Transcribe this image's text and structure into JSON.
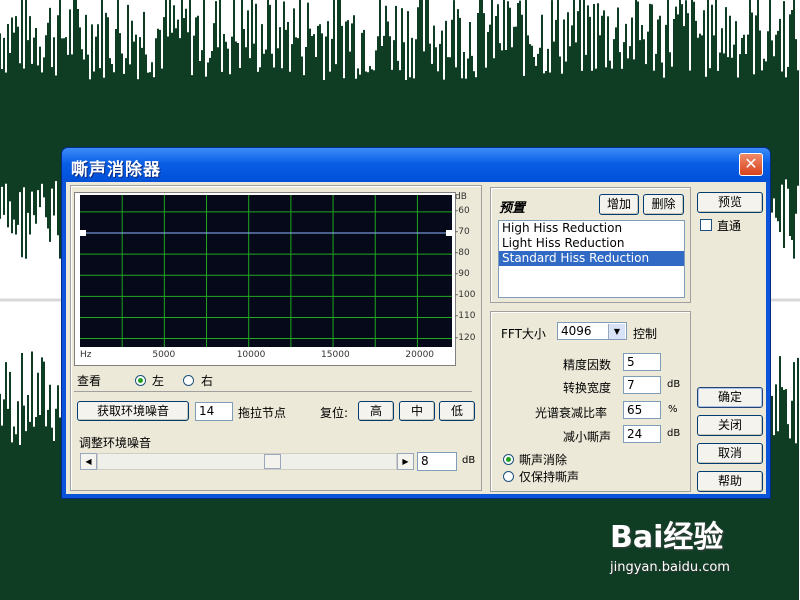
{
  "dialog": {
    "title": "嘶声消除器",
    "close_symbol": "✕"
  },
  "graph": {
    "db_unit": "dB",
    "db_ticks": [
      "-60",
      "-70",
      "-80",
      "-90",
      "-100",
      "-110",
      "-120"
    ],
    "hz_ticks": [
      "Hz",
      "5000",
      "10000",
      "15000",
      "20000"
    ],
    "noise_floor_db": -70
  },
  "view": {
    "label": "查看",
    "left": "左",
    "right": "右",
    "selected": "左"
  },
  "controls": {
    "get_noise_button": "获取环境噪音",
    "nodes_value": "14",
    "nodes_label": "拖拉节点",
    "reset_label": "复位:",
    "high": "高",
    "mid": "中",
    "low": "低",
    "adjust_label": "调整环境噪音",
    "adjust_value": "8",
    "adjust_unit": "dB",
    "slider_fraction": 0.59
  },
  "preset": {
    "title": "预置",
    "add": "增加",
    "delete": "删除",
    "items": [
      "High Hiss Reduction",
      "Light Hiss Reduction",
      "Standard Hiss Reduction"
    ],
    "selected_index": 2
  },
  "settings": {
    "fft_label": "FFT大小",
    "fft_value": "4096",
    "control_label": "控制",
    "precision_label": "精度因数",
    "precision_value": "5",
    "transition_label": "转换宽度",
    "transition_value": "7",
    "transition_unit": "dB",
    "spectral_label": "光谱衰减比率",
    "spectral_value": "65",
    "spectral_unit": "%",
    "reduce_label": "减小嘶声",
    "reduce_value": "24",
    "reduce_unit": "dB",
    "mode_remove": "嘶声消除",
    "mode_keep": "仅保持嘶声",
    "mode_selected": "嘶声消除"
  },
  "side_buttons": {
    "preview": "预览",
    "bypass": "直通",
    "ok": "确定",
    "close": "关闭",
    "cancel": "取消",
    "help": "帮助"
  },
  "watermark": {
    "logo": "Bai经验",
    "url": "jingyan.baidu.com"
  },
  "colors": {
    "waveform": "#0e3d24",
    "plot_bg": "#05091a",
    "plot_grid": "#1fa81f",
    "title_bar": "#0a5ee6",
    "selection": "#316ac5"
  }
}
